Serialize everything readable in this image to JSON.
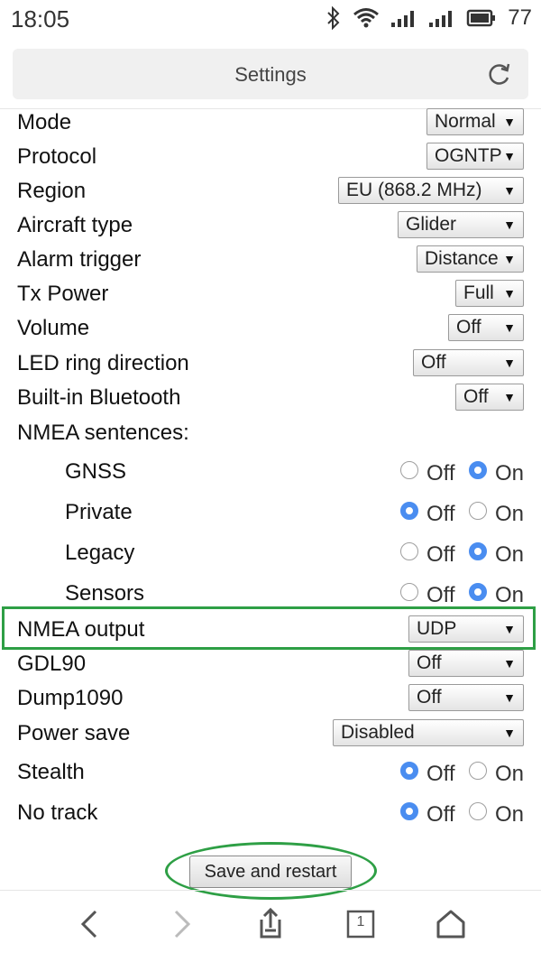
{
  "status_bar": {
    "time": "18:05",
    "battery": "77"
  },
  "header": {
    "title": "Settings"
  },
  "settings": [
    {
      "label": "Mode",
      "value": "Normal"
    },
    {
      "label": "Protocol",
      "value": "OGNTP"
    },
    {
      "label": "Region",
      "value": "EU (868.2 MHz)"
    },
    {
      "label": "Aircraft type",
      "value": "Glider"
    },
    {
      "label": "Alarm trigger",
      "value": "Distance"
    },
    {
      "label": "Tx Power",
      "value": "Full"
    },
    {
      "label": "Volume",
      "value": "Off"
    },
    {
      "label": "LED ring direction",
      "value": "Off"
    },
    {
      "label": "Built-in Bluetooth",
      "value": "Off"
    }
  ],
  "nmea_sentences": {
    "label": "NMEA sentences:",
    "items": [
      {
        "label": "GNSS",
        "selected": "On"
      },
      {
        "label": "Private",
        "selected": "Off"
      },
      {
        "label": "Legacy",
        "selected": "On"
      },
      {
        "label": "Sensors",
        "selected": "On"
      }
    ]
  },
  "radio_options": {
    "off": "Off",
    "on": "On"
  },
  "outputs": [
    {
      "label": "NMEA output",
      "value": "UDP"
    },
    {
      "label": "GDL90",
      "value": "Off"
    },
    {
      "label": "Dump1090",
      "value": "Off"
    },
    {
      "label": "Power save",
      "value": "Disabled"
    }
  ],
  "toggles": [
    {
      "label": "Stealth",
      "selected": "Off"
    },
    {
      "label": "No track",
      "selected": "Off"
    }
  ],
  "save_button": "Save and restart",
  "nav": {
    "tab_count": "1"
  },
  "colors": {
    "accent": "#4a8df0",
    "highlight": "#2e9f45"
  }
}
